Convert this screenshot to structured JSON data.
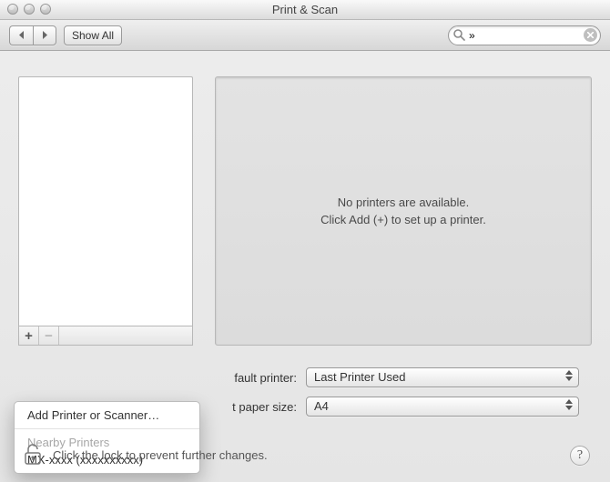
{
  "window": {
    "title": "Print & Scan"
  },
  "toolbar": {
    "back_label": "◀",
    "forward_label": "▶",
    "show_all_label": "Show All",
    "search_placeholder": "",
    "search_value": "»"
  },
  "printer_list": {
    "add_symbol": "+",
    "remove_symbol": "−"
  },
  "detail": {
    "line1": "No printers are available.",
    "line2": "Click Add (+) to set up a printer."
  },
  "defaults": {
    "default_printer_label": "fault printer:",
    "default_printer_value": "Last Printer Used",
    "paper_size_label": "t paper size:",
    "paper_size_value": "A4"
  },
  "menu": {
    "add_printer_or_scanner": "Add Printer or Scanner…",
    "nearby_heading": "Nearby Printers",
    "nearby_item": "MX-xxxx (xxxxxxxxxx)"
  },
  "footer": {
    "lock_text": "Click the lock to prevent further changes.",
    "help_symbol": "?"
  }
}
